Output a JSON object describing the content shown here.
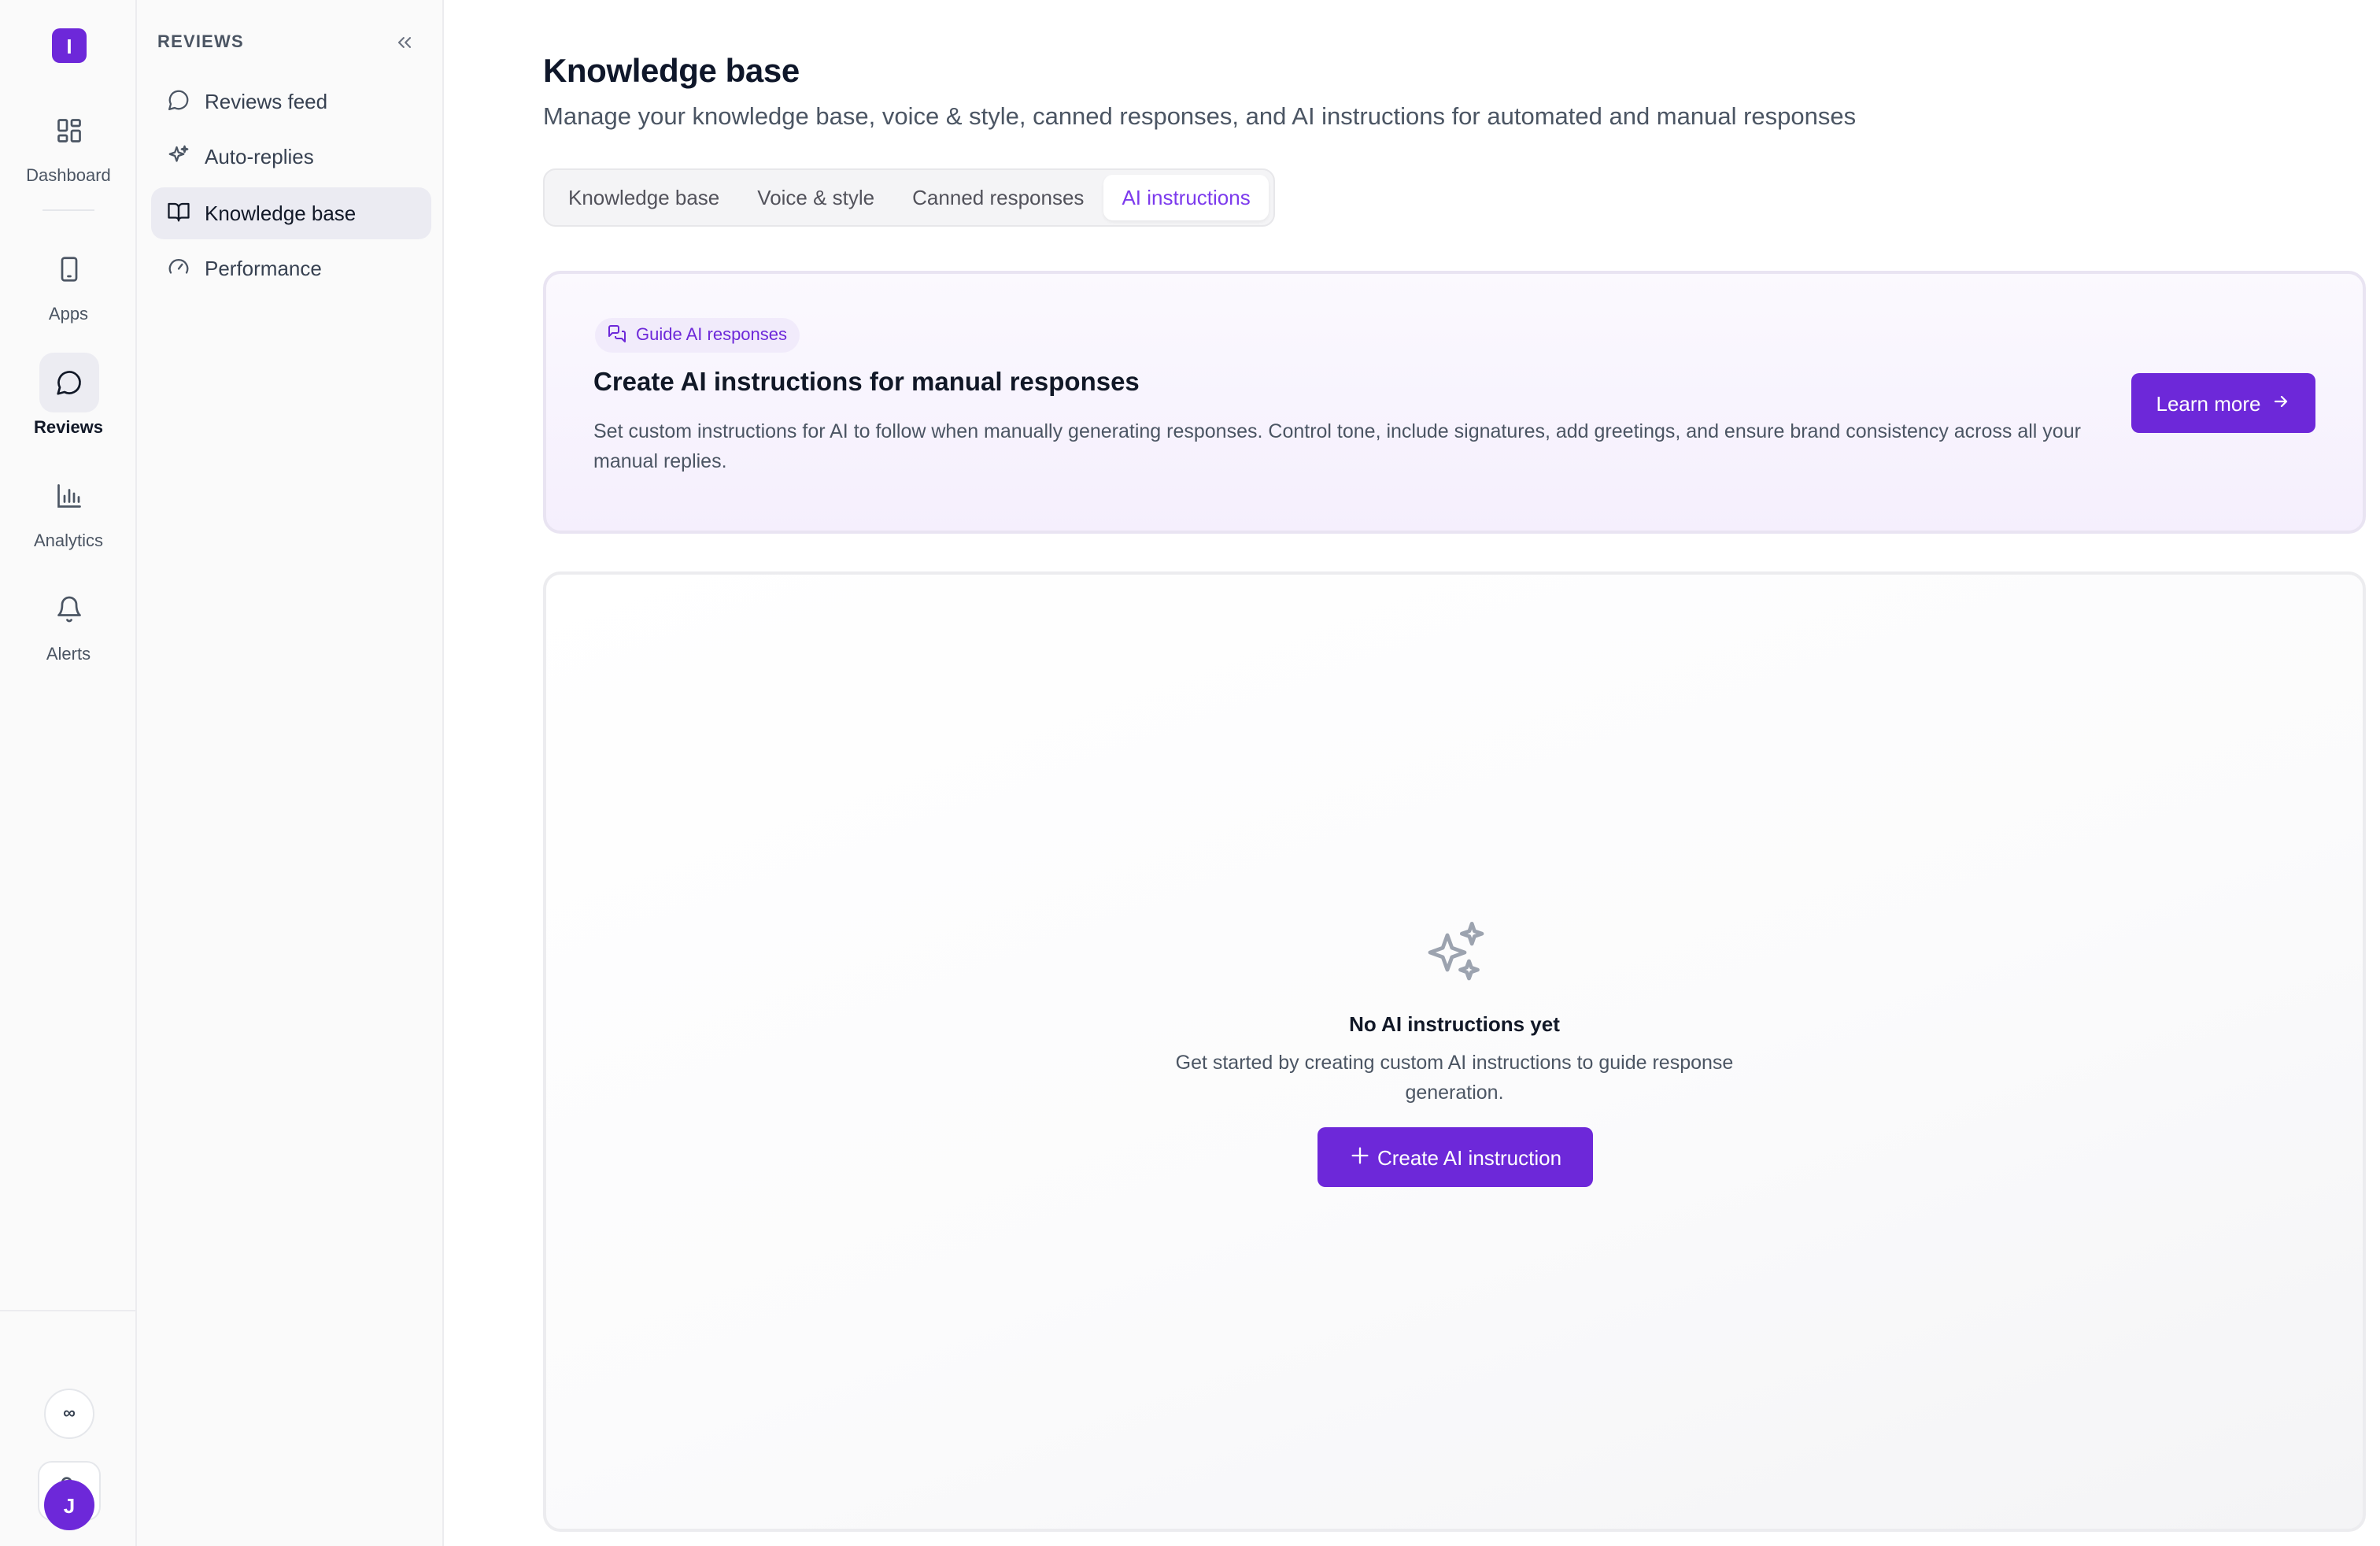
{
  "rail": {
    "logo_letter": "I",
    "items": [
      {
        "label": "Dashboard",
        "icon": "dashboard-grid-icon"
      },
      {
        "label": "Apps",
        "icon": "phone-icon"
      },
      {
        "label": "Reviews",
        "icon": "chat-bubble-icon",
        "active": true
      },
      {
        "label": "Analytics",
        "icon": "bar-chart-icon"
      },
      {
        "label": "Alerts",
        "icon": "bell-icon"
      }
    ],
    "infinity_label": "∞",
    "avatar_initial": "J"
  },
  "sidebar": {
    "title": "REVIEWS",
    "items": [
      {
        "label": "Reviews feed",
        "icon": "chat-bubble-icon"
      },
      {
        "label": "Auto-replies",
        "icon": "sparkles-icon"
      },
      {
        "label": "Knowledge base",
        "icon": "book-open-icon",
        "active": true
      },
      {
        "label": "Performance",
        "icon": "gauge-icon"
      }
    ]
  },
  "header": {
    "title": "Knowledge base",
    "subtitle": "Manage your knowledge base, voice & style, canned responses, and AI instructions for automated and manual responses"
  },
  "tabs": [
    {
      "label": "Knowledge base"
    },
    {
      "label": "Voice & style"
    },
    {
      "label": "Canned responses"
    },
    {
      "label": "AI instructions",
      "active": true
    }
  ],
  "guide": {
    "badge": "Guide AI responses",
    "title": "Create AI instructions for manual responses",
    "description": "Set custom instructions for AI to follow when manually generating responses. Control tone, include signatures, add greetings, and ensure brand consistency across all your manual replies.",
    "button_label": "Learn more"
  },
  "empty_state": {
    "title": "No AI instructions yet",
    "description": "Get started by creating custom AI instructions to guide response generation.",
    "button_label": "Create AI instruction"
  },
  "colors": {
    "accent": "#6d28d9",
    "active_tab_text": "#7c3aed"
  }
}
